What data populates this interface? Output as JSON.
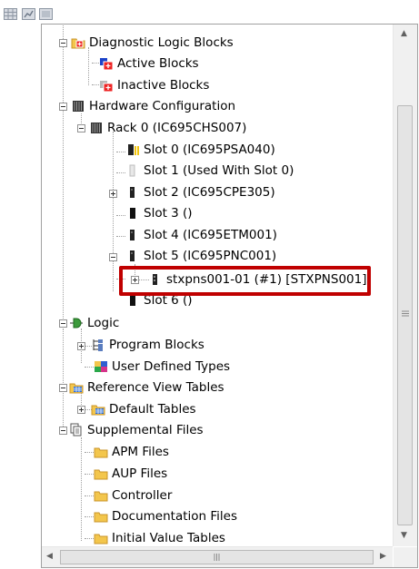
{
  "toolbar": {
    "buttons": [
      "grid-icon",
      "chart-icon",
      "table-icon"
    ]
  },
  "tree": {
    "diagnostic_logic_blocks": "Diagnostic Logic Blocks",
    "active_blocks": "Active Blocks",
    "inactive_blocks": "Inactive Blocks",
    "hardware_configuration": "Hardware Configuration",
    "rack0": "Rack 0 (IC695CHS007)",
    "slot0": "Slot 0 (IC695PSA040)",
    "slot1": "Slot 1 (Used With Slot 0)",
    "slot2": "Slot 2 (IC695CPE305)",
    "slot3": "Slot 3 ()",
    "slot4": "Slot 4 (IC695ETM001)",
    "slot5": "Slot 5 (IC695PNC001)",
    "stxpns": "stxpns001-01 (#1) [STXPNS001]",
    "slot6": "Slot 6 ()",
    "logic": "Logic",
    "program_blocks": "Program Blocks",
    "user_defined_types": "User Defined Types",
    "reference_view_tables": "Reference View Tables",
    "default_tables": "Default Tables",
    "supplemental_files": "Supplemental Files",
    "apm_files": "APM Files",
    "aup_files": "AUP Files",
    "controller": "Controller",
    "documentation_files": "Documentation Files",
    "initial_value_tables": "Initial Value Tables"
  },
  "colors": {
    "highlight": "#c00000",
    "folder": "#f3c64c"
  }
}
